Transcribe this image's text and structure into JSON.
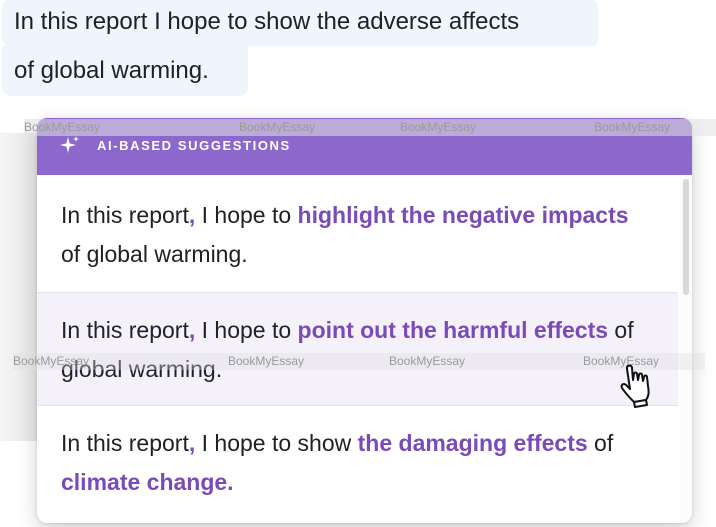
{
  "original": {
    "line1": "In this report I hope to show the adverse affects",
    "line2": "of global warming."
  },
  "popup": {
    "title": "AI-BASED SUGGESTIONS",
    "header_color": "#8d68cc",
    "accent_color": "#7a4bb8",
    "suggestions": [
      {
        "p1": "In this report",
        "p2": ",",
        "p3": " I hope to ",
        "p4": "highlight the negative impacts",
        "p5": " of global warming."
      },
      {
        "p1": "In this report",
        "p2": ",",
        "p3": " I hope to ",
        "p4": "point out the harmful effects",
        "p5": " of global warming."
      },
      {
        "p1": "In this report",
        "p2": ",",
        "p3": " I hope to show ",
        "p4": "the damaging effects",
        "p5": " of ",
        "p6": "climate change."
      }
    ]
  },
  "watermarks": {
    "text": "BookMyEssay"
  },
  "icons": {
    "header": "sparkle-icon",
    "cursor": "hand-cursor-icon"
  }
}
